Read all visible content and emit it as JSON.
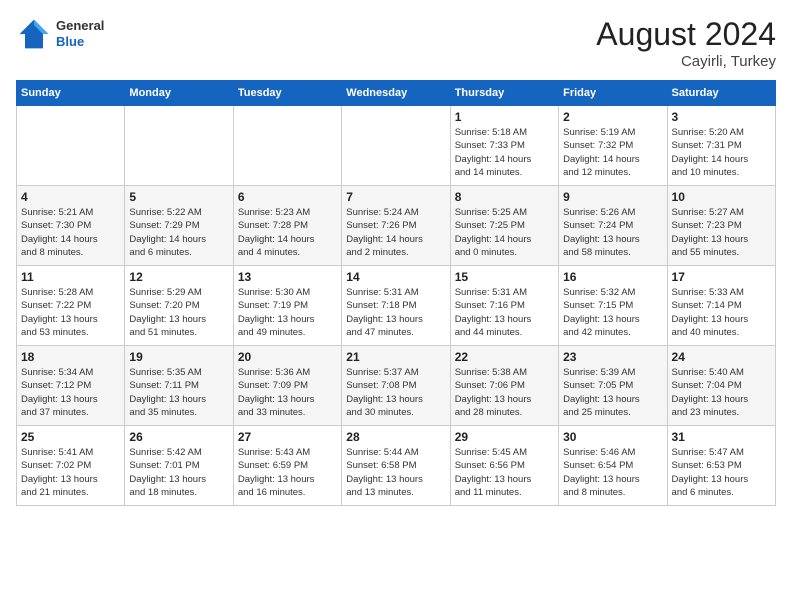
{
  "header": {
    "logo": {
      "general": "General",
      "blue": "Blue"
    },
    "month": "August 2024",
    "location": "Cayirli, Turkey"
  },
  "weekdays": [
    "Sunday",
    "Monday",
    "Tuesday",
    "Wednesday",
    "Thursday",
    "Friday",
    "Saturday"
  ],
  "weeks": [
    [
      {
        "day": "",
        "info": ""
      },
      {
        "day": "",
        "info": ""
      },
      {
        "day": "",
        "info": ""
      },
      {
        "day": "",
        "info": ""
      },
      {
        "day": "1",
        "info": "Sunrise: 5:18 AM\nSunset: 7:33 PM\nDaylight: 14 hours\nand 14 minutes."
      },
      {
        "day": "2",
        "info": "Sunrise: 5:19 AM\nSunset: 7:32 PM\nDaylight: 14 hours\nand 12 minutes."
      },
      {
        "day": "3",
        "info": "Sunrise: 5:20 AM\nSunset: 7:31 PM\nDaylight: 14 hours\nand 10 minutes."
      }
    ],
    [
      {
        "day": "4",
        "info": "Sunrise: 5:21 AM\nSunset: 7:30 PM\nDaylight: 14 hours\nand 8 minutes."
      },
      {
        "day": "5",
        "info": "Sunrise: 5:22 AM\nSunset: 7:29 PM\nDaylight: 14 hours\nand 6 minutes."
      },
      {
        "day": "6",
        "info": "Sunrise: 5:23 AM\nSunset: 7:28 PM\nDaylight: 14 hours\nand 4 minutes."
      },
      {
        "day": "7",
        "info": "Sunrise: 5:24 AM\nSunset: 7:26 PM\nDaylight: 14 hours\nand 2 minutes."
      },
      {
        "day": "8",
        "info": "Sunrise: 5:25 AM\nSunset: 7:25 PM\nDaylight: 14 hours\nand 0 minutes."
      },
      {
        "day": "9",
        "info": "Sunrise: 5:26 AM\nSunset: 7:24 PM\nDaylight: 13 hours\nand 58 minutes."
      },
      {
        "day": "10",
        "info": "Sunrise: 5:27 AM\nSunset: 7:23 PM\nDaylight: 13 hours\nand 55 minutes."
      }
    ],
    [
      {
        "day": "11",
        "info": "Sunrise: 5:28 AM\nSunset: 7:22 PM\nDaylight: 13 hours\nand 53 minutes."
      },
      {
        "day": "12",
        "info": "Sunrise: 5:29 AM\nSunset: 7:20 PM\nDaylight: 13 hours\nand 51 minutes."
      },
      {
        "day": "13",
        "info": "Sunrise: 5:30 AM\nSunset: 7:19 PM\nDaylight: 13 hours\nand 49 minutes."
      },
      {
        "day": "14",
        "info": "Sunrise: 5:31 AM\nSunset: 7:18 PM\nDaylight: 13 hours\nand 47 minutes."
      },
      {
        "day": "15",
        "info": "Sunrise: 5:31 AM\nSunset: 7:16 PM\nDaylight: 13 hours\nand 44 minutes."
      },
      {
        "day": "16",
        "info": "Sunrise: 5:32 AM\nSunset: 7:15 PM\nDaylight: 13 hours\nand 42 minutes."
      },
      {
        "day": "17",
        "info": "Sunrise: 5:33 AM\nSunset: 7:14 PM\nDaylight: 13 hours\nand 40 minutes."
      }
    ],
    [
      {
        "day": "18",
        "info": "Sunrise: 5:34 AM\nSunset: 7:12 PM\nDaylight: 13 hours\nand 37 minutes."
      },
      {
        "day": "19",
        "info": "Sunrise: 5:35 AM\nSunset: 7:11 PM\nDaylight: 13 hours\nand 35 minutes."
      },
      {
        "day": "20",
        "info": "Sunrise: 5:36 AM\nSunset: 7:09 PM\nDaylight: 13 hours\nand 33 minutes."
      },
      {
        "day": "21",
        "info": "Sunrise: 5:37 AM\nSunset: 7:08 PM\nDaylight: 13 hours\nand 30 minutes."
      },
      {
        "day": "22",
        "info": "Sunrise: 5:38 AM\nSunset: 7:06 PM\nDaylight: 13 hours\nand 28 minutes."
      },
      {
        "day": "23",
        "info": "Sunrise: 5:39 AM\nSunset: 7:05 PM\nDaylight: 13 hours\nand 25 minutes."
      },
      {
        "day": "24",
        "info": "Sunrise: 5:40 AM\nSunset: 7:04 PM\nDaylight: 13 hours\nand 23 minutes."
      }
    ],
    [
      {
        "day": "25",
        "info": "Sunrise: 5:41 AM\nSunset: 7:02 PM\nDaylight: 13 hours\nand 21 minutes."
      },
      {
        "day": "26",
        "info": "Sunrise: 5:42 AM\nSunset: 7:01 PM\nDaylight: 13 hours\nand 18 minutes."
      },
      {
        "day": "27",
        "info": "Sunrise: 5:43 AM\nSunset: 6:59 PM\nDaylight: 13 hours\nand 16 minutes."
      },
      {
        "day": "28",
        "info": "Sunrise: 5:44 AM\nSunset: 6:58 PM\nDaylight: 13 hours\nand 13 minutes."
      },
      {
        "day": "29",
        "info": "Sunrise: 5:45 AM\nSunset: 6:56 PM\nDaylight: 13 hours\nand 11 minutes."
      },
      {
        "day": "30",
        "info": "Sunrise: 5:46 AM\nSunset: 6:54 PM\nDaylight: 13 hours\nand 8 minutes."
      },
      {
        "day": "31",
        "info": "Sunrise: 5:47 AM\nSunset: 6:53 PM\nDaylight: 13 hours\nand 6 minutes."
      }
    ]
  ]
}
